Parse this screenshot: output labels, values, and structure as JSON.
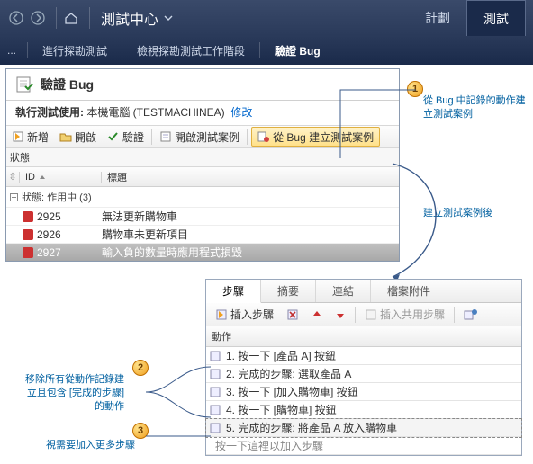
{
  "nav": {
    "title": "測試中心",
    "tab_plan": "計劃",
    "tab_test": "測試"
  },
  "toolbar": {
    "ellipsis": "...",
    "explore": "進行探勘測試",
    "review": "檢視探勘測試工作階段",
    "verify": "驗證 Bug"
  },
  "panel": {
    "title": "驗證 Bug",
    "run_label": "執行測試使用:",
    "machine": "本機電腦 (TESTMACHINEA)",
    "change": "修改",
    "btn_new": "新增",
    "btn_open": "開啟",
    "btn_verify": "驗證",
    "btn_open_case": "開啟測試案例",
    "btn_create_from_bug": "從 Bug 建立測試案例",
    "status_label": "狀態",
    "col_id": "ID",
    "col_title": "標題",
    "group": "狀態: 作用中 (3)",
    "rows": [
      {
        "id": "2925",
        "title": "無法更新購物車"
      },
      {
        "id": "2926",
        "title": "購物車未更新項目"
      },
      {
        "id": "2927",
        "title": "輸入負的數量時應用程式損毀"
      }
    ]
  },
  "sub": {
    "tab_steps": "步驟",
    "tab_summary": "摘要",
    "tab_links": "連結",
    "tab_attach": "檔案附件",
    "btn_insert_step": "插入步驟",
    "btn_insert_shared": "插入共用步驟",
    "col_action": "動作",
    "steps": [
      "1. 按一下 [產品 A] 按鈕",
      "2. 完成的步驟: 選取產品 A",
      "3. 按一下 [加入購物車] 按鈕",
      "4. 按一下 [購物車] 按鈕",
      "5. 完成的步驟: 將產品 A 放入購物車"
    ],
    "hint": "按一下這裡以加入步驟"
  },
  "callouts": {
    "c1": "從 Bug 中記錄的動作建立測試案例",
    "mid": "建立測試案例後",
    "c2": "移除所有從動作記錄建立且包含 [完成的步驟] 的動作",
    "c3": "視需要加入更多步驟"
  }
}
